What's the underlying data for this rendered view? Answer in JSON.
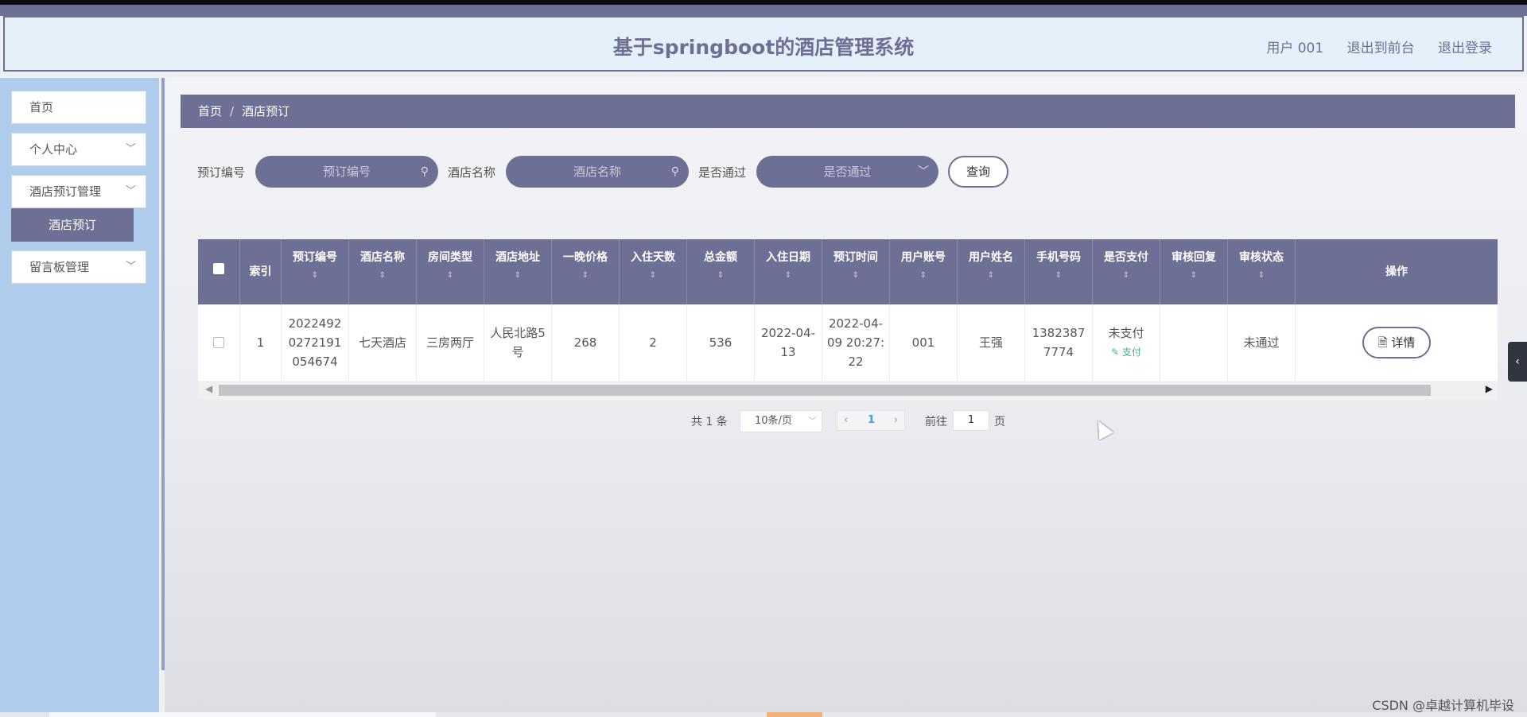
{
  "header": {
    "title": "基于springboot的酒店管理系统",
    "user": "用户 001",
    "to_front": "退出到前台",
    "logout": "退出登录"
  },
  "sidebar": {
    "items": [
      {
        "label": "首页"
      },
      {
        "label": "个人中心"
      },
      {
        "label": "酒店预订管理"
      },
      {
        "label": "留言板管理"
      }
    ],
    "submenu_active": "酒店预订",
    "chevron": "﹀"
  },
  "breadcrumb": {
    "home": "首页",
    "sep": "/",
    "current": "酒店预订"
  },
  "search": {
    "order_no_label": "预订编号",
    "order_no_placeholder": "预订编号",
    "hotel_label": "酒店名称",
    "hotel_placeholder": "酒店名称",
    "approved_label": "是否通过",
    "approved_placeholder": "是否通过",
    "query_button": "查询",
    "search_icon": "search-icon"
  },
  "table": {
    "headers": {
      "index": "索引",
      "order_no": "预订编号",
      "hotel_name": "酒店名称",
      "room_type": "房间类型",
      "address": "酒店地址",
      "price_per_night": "一晚价格",
      "nights": "入住天数",
      "total": "总金额",
      "checkin_date": "入住日期",
      "booking_time": "预订时间",
      "account": "用户账号",
      "name": "用户姓名",
      "phone": "手机号码",
      "paid": "是否支付",
      "review_reply": "审核回复",
      "review_status": "审核状态",
      "actions": "操作"
    },
    "sort_glyph": "⇕",
    "rows": [
      {
        "index": "1",
        "order_no": "20224920272191054674",
        "hotel_name": "七天酒店",
        "room_type": "三房两厅",
        "address": "人民北路5号",
        "price_per_night": "268",
        "nights": "2",
        "total": "536",
        "checkin_date": "2022-04-13",
        "booking_time": "2022-04-09 20:27:22",
        "account": "001",
        "name": "王强",
        "phone": "13823877774",
        "paid": "未支付",
        "pay_link": "✎ 支付",
        "review_reply": "",
        "review_status": "未通过",
        "detail_button": "🗎 详情"
      }
    ]
  },
  "pagination": {
    "total": "共 1 条",
    "page_size": "10条/页",
    "prev": "‹",
    "current_page": "1",
    "next": "›",
    "goto_label": "前往",
    "goto_value": "1",
    "goto_suffix": "页"
  },
  "side_tab": "‹",
  "watermark": "CSDN @卓越计算机毕设",
  "colors": {
    "primary": "#6e6f95",
    "sidebar": "#b0ccec",
    "header_bg": "#e6f0fb",
    "pay_green": "#3bb47b"
  }
}
